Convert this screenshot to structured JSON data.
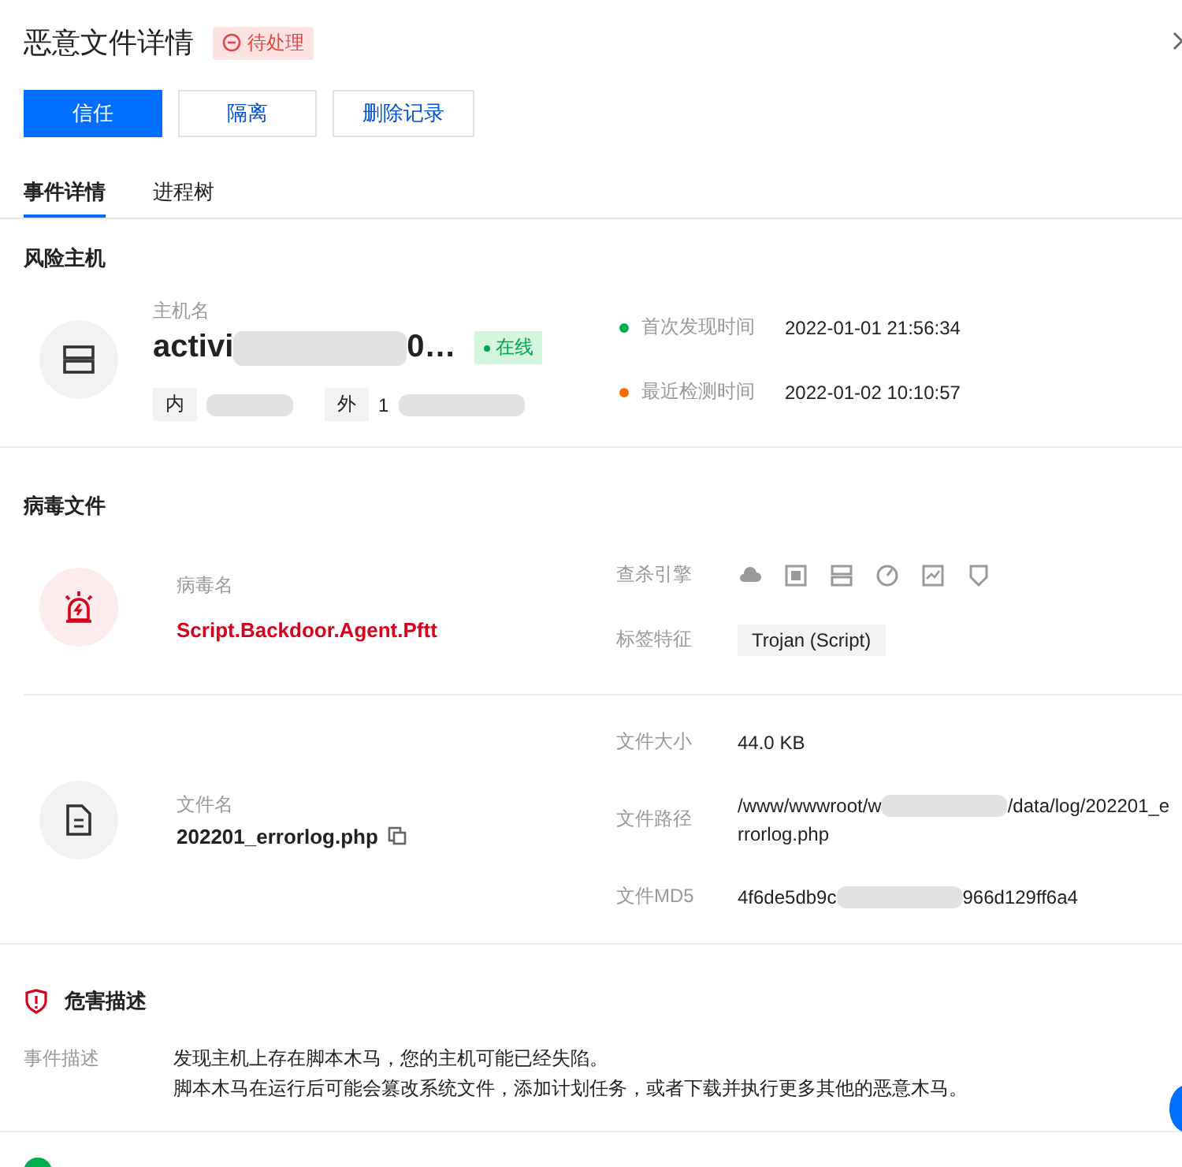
{
  "header": {
    "title": "恶意文件详情",
    "status": {
      "label": "待处理",
      "kind": "pending"
    }
  },
  "buttons": [
    {
      "label": "信任",
      "kind": "primary"
    },
    {
      "label": "隔离",
      "kind": "default"
    },
    {
      "label": "删除记录",
      "kind": "default"
    }
  ],
  "tabs": [
    {
      "label": "事件详情",
      "selected": true
    },
    {
      "label": "进程树",
      "selected": false
    }
  ],
  "risk_host": {
    "heading": "风险主机",
    "name_label": "主机名",
    "name_start": "activi",
    "name_end": "0…",
    "online_tag": "在线",
    "ips": [
      {
        "label": "内"
      },
      {
        "label": "外",
        "value_start": "1"
      }
    ],
    "times": [
      {
        "label": "首次发现时间",
        "value": "2022-01-01 21:56:34",
        "color": "#00b050"
      },
      {
        "label": "最近检测时间",
        "value": "2022-01-02 10:10:57",
        "color": "#ff6a00"
      }
    ]
  },
  "virus_file": {
    "heading": "病毒文件",
    "virus_label": "病毒名",
    "virus_name": "Script.Backdoor.Agent.Pftt",
    "engine_label": "查杀引擎",
    "tag_label": "标签特征",
    "tags": [
      "Trojan (Script)"
    ],
    "file_label": "文件名",
    "file_name": "202201_errorlog.php",
    "details": [
      {
        "label": "文件大小",
        "value_start": "44.0 KB"
      },
      {
        "label": "文件路径",
        "value_start": "/www/wwwroot/w",
        "value_end": "/data/log/202201_e",
        "value_next_line": "rrorlog.php"
      },
      {
        "label": "文件MD5",
        "value_start": "4f6de5db9c",
        "value_end": "966d129ff6a4"
      }
    ]
  },
  "harm": {
    "heading": "危害描述",
    "desc_label": "事件描述",
    "desc_lines": [
      "发现主机上存在脚本木马，您的主机可能已经失陷。",
      "脚本木马在运行后可能会篡改系统文件，添加计划任务，或者下载并执行更多其他的恶意木马。"
    ]
  }
}
